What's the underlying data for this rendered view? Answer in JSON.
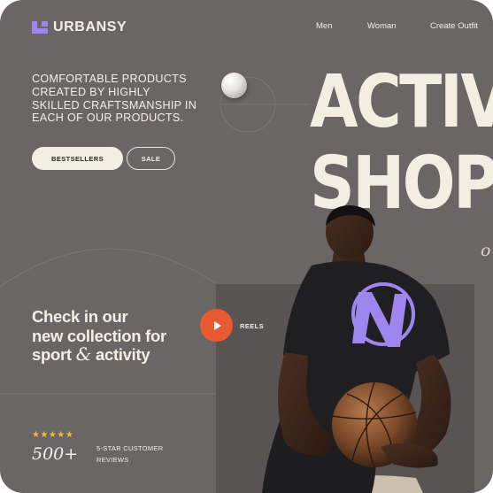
{
  "brand": {
    "name": "URBANSY",
    "logo_color": "#9e86ef"
  },
  "nav": {
    "items": [
      "Men",
      "Woman",
      "Create Outfit"
    ]
  },
  "hero": {
    "intro": "COMFORTABLE PRODUCTS CREATED BY HIGHLY SKILLED CRAFTSMANSHIP IN EACH OF OUR PRODUCTS.",
    "heading_line1": "ACTIV",
    "heading_line2": "SHOP",
    "script_fragment": "o",
    "buttons": {
      "bestsellers": "BESTSELLERS",
      "sale": "SALE"
    }
  },
  "collection": {
    "headline_line1": "Check in our",
    "headline_line2": "new collection for",
    "headline_word1": "sport",
    "headline_amp": "&",
    "headline_word2": "activity",
    "reels_label": "REELS"
  },
  "rating": {
    "stars": "★★★★★",
    "count": "500+",
    "label": "5-STAR CUSTOMER REVIEWS"
  },
  "colors": {
    "background": "#6a6665",
    "panel": "#585453",
    "accent_play": "#ea5a32",
    "star": "#f2b83c",
    "text_light": "#f4efe6"
  },
  "icons": {
    "logo": "urbansy-logo-icon",
    "play": "play-icon",
    "ball": "volleyball-icon"
  }
}
